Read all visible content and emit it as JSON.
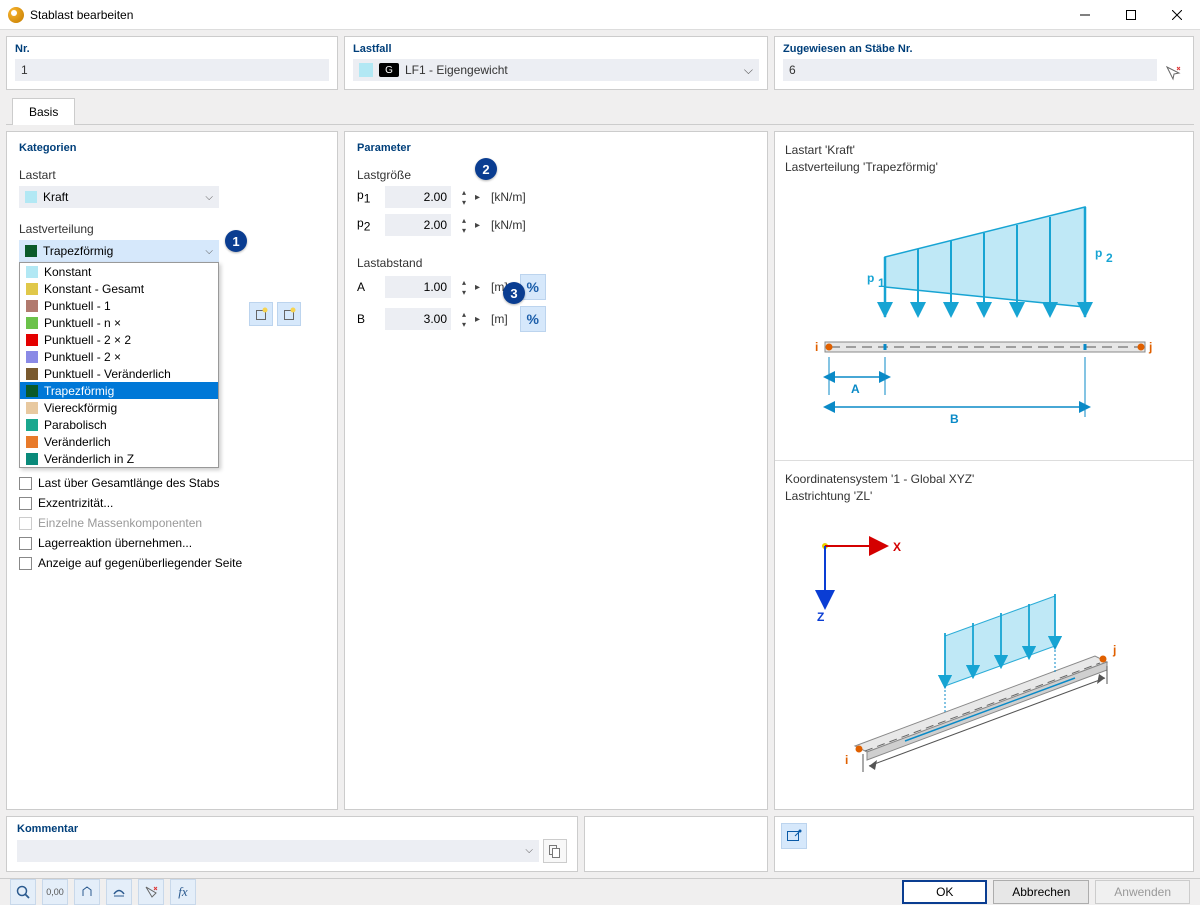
{
  "window": {
    "title": "Stablast bearbeiten"
  },
  "top": {
    "nr_label": "Nr.",
    "nr_value": "1",
    "lf_label": "Lastfall",
    "lf_badge": "G",
    "lf_value": "LF1 - Eigengewicht",
    "zg_label": "Zugewiesen an Stäbe Nr.",
    "zg_value": "6"
  },
  "tabs": {
    "basis": "Basis"
  },
  "cat": {
    "heading": "Kategorien",
    "lastart_lbl": "Lastart",
    "lastart_val": "Kraft",
    "lastvert_lbl": "Lastverteilung",
    "lastvert_val": "Trapezförmig",
    "items": [
      {
        "c": "#b2e8f4",
        "t": "Konstant"
      },
      {
        "c": "#e0c84a",
        "t": "Konstant - Gesamt"
      },
      {
        "c": "#b17a6e",
        "t": "Punktuell - 1"
      },
      {
        "c": "#6bc24a",
        "t": "Punktuell - n ×"
      },
      {
        "c": "#e40000",
        "t": "Punktuell - 2 × 2"
      },
      {
        "c": "#8a8ae6",
        "t": "Punktuell - 2 ×"
      },
      {
        "c": "#7a5a2f",
        "t": "Punktuell - Veränderlich"
      },
      {
        "c": "#0a5a2a",
        "t": "Trapezförmig"
      },
      {
        "c": "#e8c9a0",
        "t": "Viereckförmig"
      },
      {
        "c": "#1aa78e",
        "t": "Parabolisch"
      },
      {
        "c": "#e87a2a",
        "t": "Veränderlich"
      },
      {
        "c": "#0a8a7a",
        "t": "Veränderlich in Z"
      }
    ],
    "opts": {
      "a": "Last über Gesamtlänge des Stabs",
      "b": "Exzentrizität...",
      "c": "Einzelne Massenkomponenten",
      "d": "Lagerreaktion übernehmen...",
      "e": "Anzeige auf gegenüberliegender Seite"
    }
  },
  "param": {
    "heading": "Parameter",
    "lastg_lbl": "Lastgröße",
    "p1_lbl": "p1",
    "p1_val": "2.00",
    "p1_unit": "[kN/m]",
    "p2_lbl": "p2",
    "p2_val": "2.00",
    "p2_unit": "[kN/m]",
    "lasta_lbl": "Lastabstand",
    "a_lbl": "A",
    "a_val": "1.00",
    "a_unit": "[m]",
    "b_lbl": "B",
    "b_val": "3.00",
    "b_unit": "[m]",
    "pct": "%"
  },
  "right": {
    "t1a": "Lastart 'Kraft'",
    "t1b": "Lastverteilung 'Trapezförmig'",
    "t2a": "Koordinatensystem '1 - Global XYZ'",
    "t2b": "Lastrichtung 'ZL'",
    "p1": "p1",
    "p2": "p2",
    "i": "i",
    "j": "j",
    "A": "A",
    "B": "B",
    "X": "X",
    "Z": "Z"
  },
  "komment": {
    "heading": "Kommentar"
  },
  "footer": {
    "ok": "OK",
    "cancel": "Abbrechen",
    "apply": "Anwenden"
  }
}
